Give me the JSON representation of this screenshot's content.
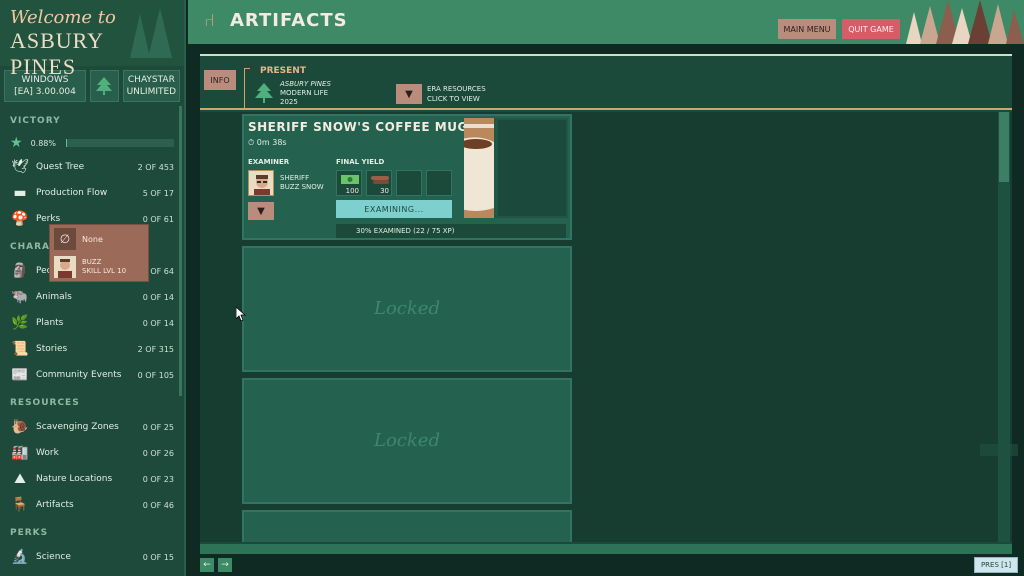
{
  "sidebar": {
    "logo_welcome": "Welcome to",
    "logo_town": "ASBURY PINES",
    "platform": {
      "os": "WINDOWS",
      "version": "[EA] 3.00.004",
      "player": "CHAYSTAR",
      "mode": "UNLIMITED"
    },
    "sections": {
      "victory": "VICTORY",
      "characters": "CHARACTERS",
      "resources": "RESOURCES",
      "perks": "PERKS"
    },
    "victory_pct": "0.88%",
    "victory_fill": 0.0088,
    "victory_items": [
      {
        "label": "Quest Tree",
        "count": "2 OF 453",
        "icon": "dove-icon"
      },
      {
        "label": "Production Flow",
        "count": "5 OF 17",
        "icon": "couch-icon"
      },
      {
        "label": "Perks",
        "count": "0 OF 61",
        "icon": "mushroom-icon"
      }
    ],
    "character_items": [
      {
        "label": "People",
        "count": "2 OF 64",
        "icon": "moai-icon"
      },
      {
        "label": "Animals",
        "count": "0 OF 14",
        "icon": "bison-icon"
      },
      {
        "label": "Plants",
        "count": "0 OF 14",
        "icon": "leaf-icon"
      },
      {
        "label": "Stories",
        "count": "2 OF 315",
        "icon": "scroll-icon"
      },
      {
        "label": "Community Events",
        "count": "0 OF 105",
        "icon": "newspaper-icon"
      }
    ],
    "resource_items": [
      {
        "label": "Scavenging Zones",
        "count": "0 OF 25",
        "icon": "snail-icon"
      },
      {
        "label": "Work",
        "count": "0 OF 26",
        "icon": "building-icon"
      },
      {
        "label": "Nature Locations",
        "count": "0 OF 23",
        "icon": "mountain-icon"
      },
      {
        "label": "Artifacts",
        "count": "0 OF 46",
        "icon": "chair-icon"
      }
    ],
    "perk_items": [
      {
        "label": "Science",
        "count": "0 OF 15",
        "icon": "microscope-icon"
      }
    ]
  },
  "header": {
    "title": "ARTIFACTS",
    "main_menu": "MAIN MENU",
    "quit_game": "QUIT GAME"
  },
  "info_bar": {
    "info_label": "INFO",
    "era_title": "PRESENT",
    "era_town": "ASBURY PINES",
    "era_name": "MODERN LIFE",
    "era_year": "2025",
    "era_resources_line1": "ERA RESOURCES",
    "era_resources_line2": "CLICK TO VIEW",
    "dropdown_arrow": "▼"
  },
  "artifact": {
    "name": "SHERIFF SNOW'S COFFEE MUG",
    "timer": "0m 38s",
    "examiner_label": "EXAMINER",
    "examiner_line1": "SHERIFF",
    "examiner_line2": "BUZZ SNOW",
    "final_yield_label": "FINAL YIELD",
    "yield_values": [
      "100",
      "30"
    ],
    "examining_label": "EXAMINING...",
    "progress_text": "30% EXAMINED (22 / 75 XP)",
    "progress_fraction": 0.3
  },
  "dropdown": {
    "none_label": "None",
    "option_line1": "BUZZ",
    "option_line2": "SKILL LVL 10"
  },
  "locked_label": "Locked",
  "footer": {
    "prev": "←",
    "next": "→",
    "pres": "PRES [1]"
  },
  "colors": {
    "sidebar_bg": "#1d4a3b",
    "header_bg": "#3e8a67",
    "accent_quit": "#d65d68",
    "accent_button": "#b98c7d",
    "examining": "#7ed0cf"
  }
}
